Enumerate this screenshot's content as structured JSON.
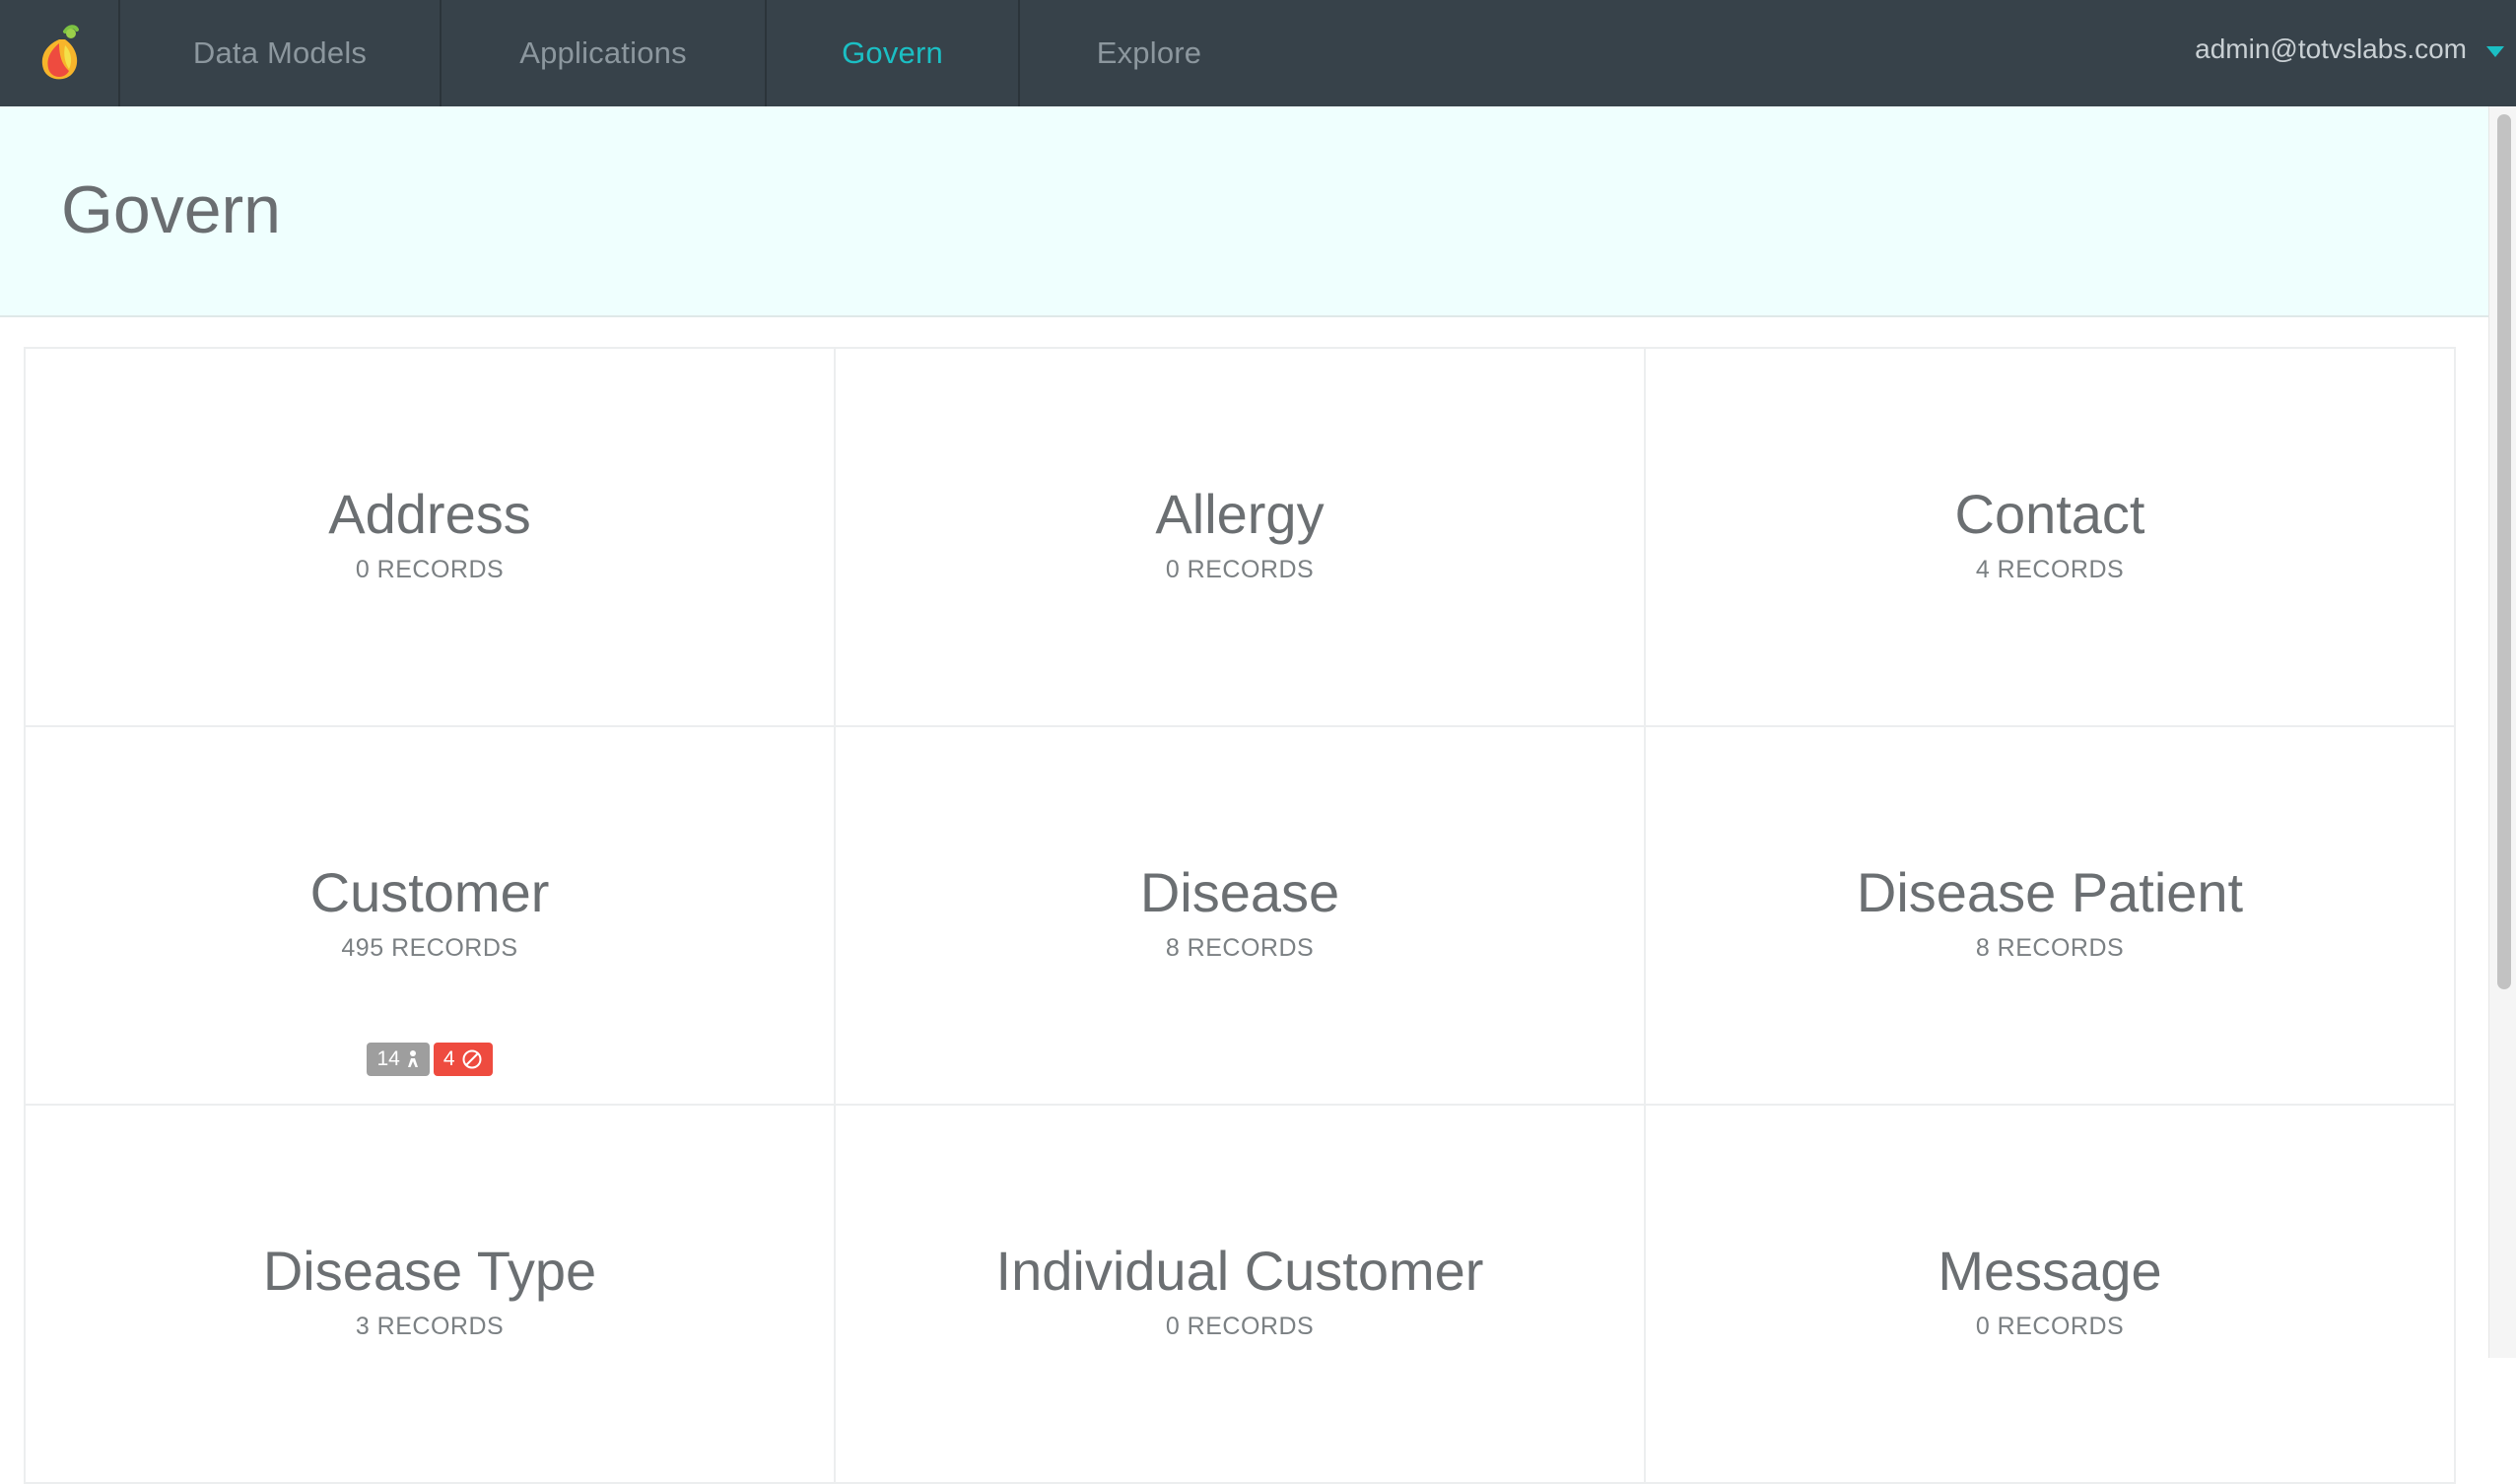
{
  "nav": {
    "items": [
      {
        "label": "Data Models",
        "active": false
      },
      {
        "label": "Applications",
        "active": false
      },
      {
        "label": "Govern",
        "active": true
      },
      {
        "label": "Explore",
        "active": false
      }
    ],
    "user_email": "admin@totvslabs.com",
    "active_color": "#1bbfc4",
    "bar_color": "#37424a"
  },
  "header": {
    "title": "Govern",
    "background": "#effffe"
  },
  "cards": [
    {
      "name": "Address",
      "count": "0 RECORDS"
    },
    {
      "name": "Allergy",
      "count": "0 RECORDS"
    },
    {
      "name": "Contact",
      "count": "4 RECORDS"
    },
    {
      "name": "Customer",
      "count": "495 RECORDS",
      "badges": {
        "merge_count": "14",
        "merge_icon": "person-merge-icon",
        "blocked_count": "4",
        "blocked_icon": "blocked-icon"
      }
    },
    {
      "name": "Disease",
      "count": "8 RECORDS"
    },
    {
      "name": "Disease Patient",
      "count": "8 RECORDS"
    },
    {
      "name": "Disease Type",
      "count": "3 RECORDS"
    },
    {
      "name": "Individual Customer",
      "count": "0 RECORDS"
    },
    {
      "name": "Message",
      "count": "0 RECORDS"
    }
  ],
  "badge_colors": {
    "gray": "#9e9e9e",
    "red": "#ee4b3f"
  }
}
